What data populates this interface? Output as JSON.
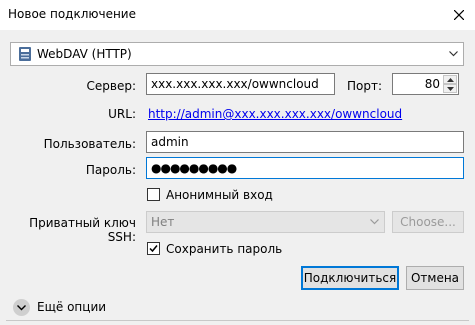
{
  "window": {
    "title": "Новое подключение"
  },
  "protocol": {
    "selected": "WebDAV (HTTP)",
    "icon": "webdav-server-icon"
  },
  "server": {
    "label": "Сервер:",
    "value": "xxx.xxx.xxx.xxx/owwncloud"
  },
  "port": {
    "label": "Порт:",
    "value": "80"
  },
  "url": {
    "label": "URL:",
    "value": "http://admin@xxx.xxx.xxx.xxx/owwncloud"
  },
  "username": {
    "label": "Пользователь:",
    "value": "admin"
  },
  "password": {
    "label": "Пароль:",
    "value": "●●●●●●●●●"
  },
  "anonymous": {
    "label": "Анонимный вход",
    "checked": false
  },
  "ssh_key": {
    "label": "Приватный ключ SSH:",
    "value": "Нет",
    "choose_label": "Choose..."
  },
  "save_password": {
    "label": "Сохранить пароль",
    "checked": true
  },
  "buttons": {
    "connect": "Подключиться",
    "cancel": "Отмена"
  },
  "more_options": {
    "label": "Ещё опции"
  },
  "colors": {
    "accent": "#0078d7",
    "link": "#0000ee",
    "window_bg": "#f0f0f0"
  }
}
